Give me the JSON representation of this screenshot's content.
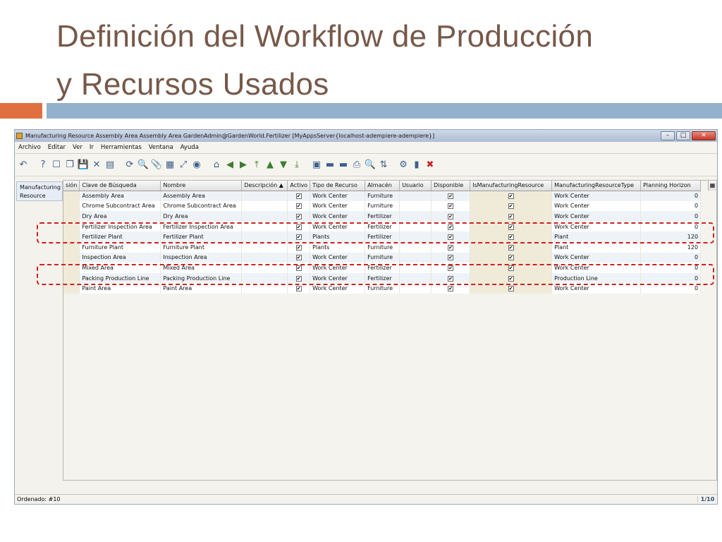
{
  "slide": {
    "title_line1": "Definición del Workflow de Producción",
    "title_line2": "y Recursos Usados"
  },
  "window": {
    "title": "Manufacturing Resource  Assembly Area  Assembly Area  GardenAdmin@GardenWorld.Fertilizer [MyAppsServer{localhost-adempiere-adempiere}]",
    "minimize": "–",
    "maximize": "□",
    "close": "✕"
  },
  "menu": [
    "Archivo",
    "Editar",
    "Ver",
    "Ir",
    "Herramientas",
    "Ventana",
    "Ayuda"
  ],
  "tab": {
    "label": "Manufacturing Resource"
  },
  "grid": {
    "columns": [
      "sión",
      "Clave de Búsqueda",
      "Nombre",
      "Descripción ▲",
      "Activo",
      "Tipo de Recurso",
      "Almacén",
      "Usuario",
      "Disponible",
      "IsManufacturingResource",
      "ManufacturingResourceType",
      "Planning Horizon"
    ],
    "rows": [
      [
        "",
        "Assembly Area",
        "Assembly Area",
        "",
        "✔",
        "Work Center",
        "Furniture",
        "",
        "✔",
        "✔",
        "Work Center",
        "0"
      ],
      [
        "",
        "Chrome Subcontract Area",
        "Chrome Subcontract Area",
        "",
        "✔",
        "Work Center",
        "Furniture",
        "",
        "✔",
        "✔",
        "Work Center",
        "0"
      ],
      [
        "",
        "Dry Area",
        "Dry Area",
        "",
        "✔",
        "Work Center",
        "Fertilizer",
        "",
        "✔",
        "✔",
        "Work Center",
        "0"
      ],
      [
        "",
        "Fertilizer Inspection Area",
        "Fertilizer Inspection Area",
        "",
        "✔",
        "Work Center",
        "Fertilizer",
        "",
        "✔",
        "✔",
        "Work Center",
        "0"
      ],
      [
        "",
        "Fertilizer Plant",
        "Fertilizer Plant",
        "",
        "✔",
        "Plants",
        "Fertilizer",
        "",
        "✔",
        "✔",
        "Plant",
        "120"
      ],
      [
        "",
        "Furniture Plant",
        "Furniture Plant",
        "",
        "✔",
        "Plants",
        "Furniture",
        "",
        "✔",
        "✔",
        "Plant",
        "120"
      ],
      [
        "",
        "Inspection Area",
        "Inspection Area",
        "",
        "✔",
        "Work Center",
        "Furniture",
        "",
        "✔",
        "✔",
        "Work Center",
        "0"
      ],
      [
        "",
        "Mixed Area",
        "Mixed Area",
        "",
        "✔",
        "Work Center",
        "Fertilizer",
        "",
        "✔",
        "✔",
        "Work Center",
        "0"
      ],
      [
        "",
        "Packing Production Line",
        "Packing Production Line",
        "",
        "✔",
        "Work Center",
        "Fertilizer",
        "",
        "✔",
        "✔",
        "Production Line",
        "0"
      ],
      [
        "",
        "Paint Area",
        "Paint Area",
        "",
        "✔",
        "Work Center",
        "Furniture",
        "",
        "✔",
        "✔",
        "Work Center",
        "0"
      ]
    ]
  },
  "status": {
    "text": "Ordenado: #10",
    "page": "1/10"
  },
  "toolbar_icons": [
    "undo-icon",
    "help-icon",
    "new-record-icon",
    "copy-record-icon",
    "save-icon",
    "delete-icon",
    "print-icon",
    "refresh-icon",
    "find-icon",
    "attachment-icon",
    "grid-toggle-icon",
    "zoom-icon",
    "history-icon",
    "home-icon",
    "previous-icon",
    "next-icon",
    "first-icon",
    "up-icon",
    "down-icon",
    "last-icon",
    "report-icon",
    "archive-icon",
    "product-info-icon",
    "print-preview-icon",
    "zoom-across-icon",
    "request-icon",
    "workflow-icon",
    "chat-icon",
    "exit-icon"
  ],
  "toolbar_glyphs": [
    "↶",
    "?",
    "☐",
    "❐",
    "💾",
    "✕",
    "▤",
    "⟳",
    "🔍",
    "📎",
    "▦",
    "⤢",
    "◉",
    "⌂",
    "◀",
    "▶",
    "⤒",
    "▲",
    "▼",
    "⤓",
    "▣",
    "▬",
    "▬",
    "⎙",
    "🔍",
    "⇅",
    "⚙",
    "▮",
    "✖"
  ],
  "colors": {
    "title": "#76594a",
    "accent_orange": "#e0703f",
    "accent_blue": "#93b1cc",
    "highlight": "#d02020",
    "exit_icon": "#cc2222"
  }
}
